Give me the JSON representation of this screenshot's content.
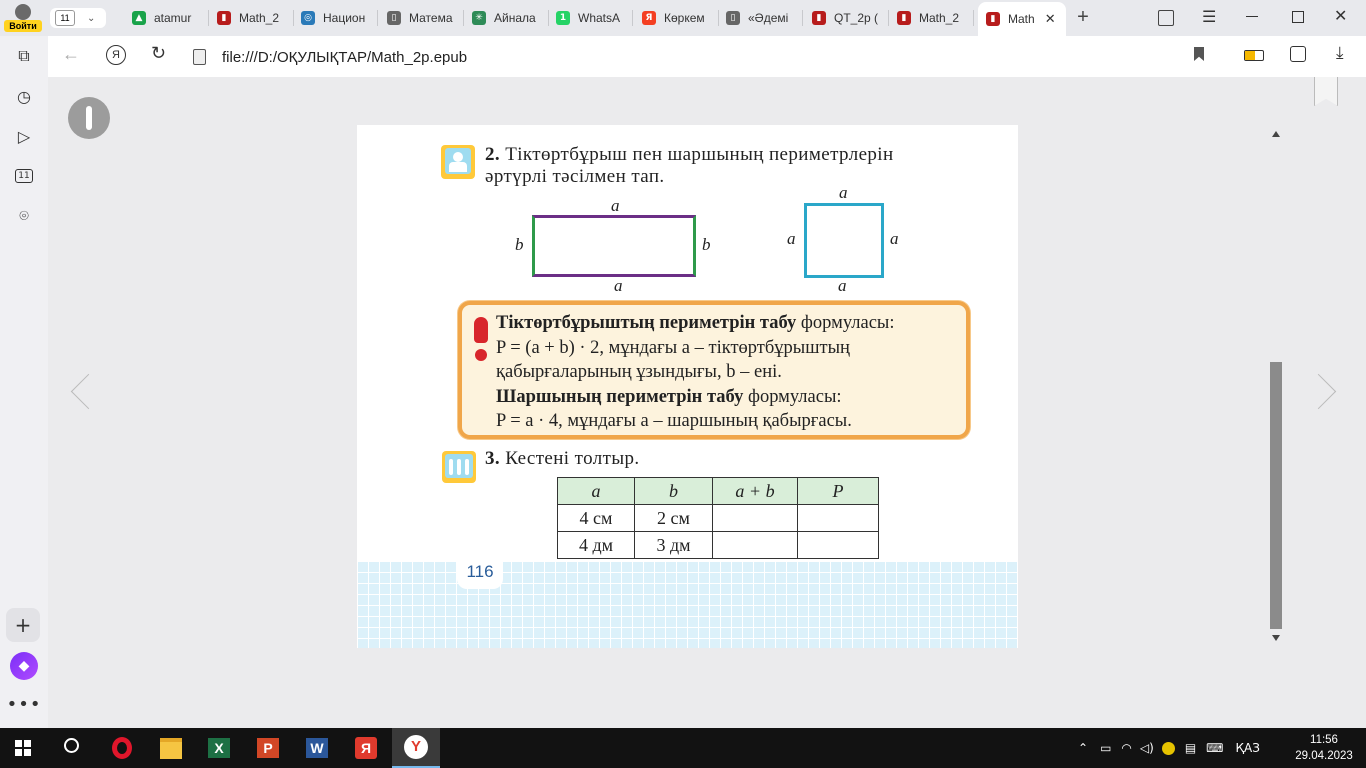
{
  "browser": {
    "profile_label": "Войти",
    "tab_count": "11",
    "tabs": [
      {
        "label": "atamur",
        "color": "#19a34a",
        "glyph": "▲"
      },
      {
        "label": "Math_2",
        "color": "#b71c1c",
        "glyph": "▮"
      },
      {
        "label": "Национ",
        "color": "#2a7ab8",
        "glyph": "◎"
      },
      {
        "label": "Матема",
        "color": "#666666",
        "glyph": "▯"
      },
      {
        "label": "Айнала",
        "color": "#2e8b57",
        "glyph": "✳"
      },
      {
        "label": "WhatsA",
        "color": "#25d366",
        "glyph": "1"
      },
      {
        "label": "Көркем",
        "color": "#f43f22",
        "glyph": "Я"
      },
      {
        "label": "«Әдемі",
        "color": "#666666",
        "glyph": "▯"
      },
      {
        "label": "QT_2р (",
        "color": "#b71c1c",
        "glyph": "▮"
      },
      {
        "label": "Math_2",
        "color": "#b71c1c",
        "glyph": "▮"
      },
      {
        "label": "Math",
        "color": "#b71c1c",
        "glyph": "▮"
      }
    ],
    "address": "file:///D:/ОҚУЛЫҚТАР/Math_2p.epub"
  },
  "book": {
    "task2": {
      "number": "2.",
      "text_line1": "Тіктөртбұрыш пен шаршының периметрлерін",
      "text_line2": "әртүрлі тәсілмен тап."
    },
    "rect_labels": {
      "top": "a",
      "bottom": "a",
      "left": "b",
      "right": "b"
    },
    "square_labels": {
      "top": "a",
      "bottom": "a",
      "left": "a",
      "right": "a"
    },
    "rule": {
      "line1_bold": "Тіктөртбұрыштың периметрін табу",
      "line1_rest": " формуласы:",
      "line2": "P = (a + b) · 2, мұндағы  a – тіктөртбұрыштың",
      "line3": "қабырғаларының ұзындығы, b – ені.",
      "line4_bold": "Шаршының периметрін табу",
      "line4_rest": " формуласы:",
      "line5": "P = a · 4, мұндағы a – шаршының қабырғасы."
    },
    "task3": {
      "number": "3.",
      "text": "Кестені толтыр."
    },
    "table": {
      "headers": [
        "a",
        "b",
        "a + b",
        "P"
      ],
      "rows": [
        [
          "4 см",
          "2 см",
          "",
          ""
        ],
        [
          "4 дм",
          "3 дм",
          "",
          ""
        ]
      ]
    },
    "page_number": "116"
  },
  "taskbar": {
    "language": "ҚАЗ",
    "time": "11:56",
    "date": "29.04.2023"
  },
  "colors": {
    "rect_long": "#6b2f86",
    "rect_short": "#2f9a4a",
    "square": "#2aa7c9",
    "rule_border": "#f0a64a",
    "rule_bg": "#fdf3dd",
    "table_header": "#d9eed9",
    "grid_bg": "#dcf1fa"
  }
}
